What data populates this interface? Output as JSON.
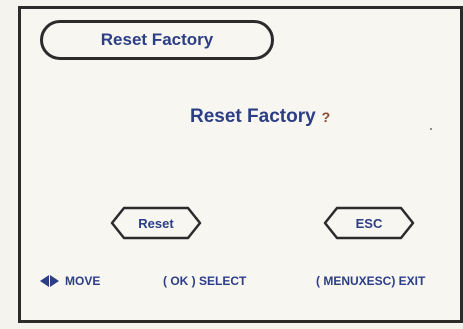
{
  "menu": {
    "title": "Reset Factory",
    "prompt": "Reset Factory",
    "prompt_mark": "?"
  },
  "buttons": {
    "reset_label": "Reset",
    "esc_label": "ESC"
  },
  "footer": {
    "move_label": "MOVE",
    "select_label": "( OK ) SELECT",
    "exit_label": "( MENUXESC) EXIT"
  },
  "icons": {
    "move": [
      "arrow-left-icon",
      "arrow-right-icon"
    ]
  },
  "colors": {
    "text": "#2c3e86",
    "border": "#2b2b2b",
    "background": "#f7f6f1"
  }
}
